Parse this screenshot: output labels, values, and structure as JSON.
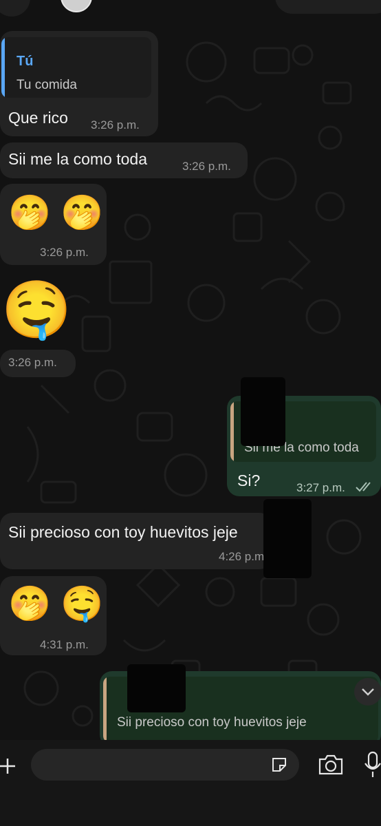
{
  "colors": {
    "chat_background": "#121212",
    "incoming_bubble": "#232323",
    "outgoing_bubble": "#1f3a2c",
    "reply_bar_blue": "#5aa7f5",
    "reply_bar_tan": "#c8a581",
    "read_check": "#a9c1b5"
  },
  "messages": [
    {
      "direction": "in",
      "reply_author": "Tú",
      "reply_text": "Tu comida",
      "text": "Que rico",
      "time": "3:26 p.m."
    },
    {
      "direction": "in",
      "text": "Sii me la como toda",
      "time": "3:26 p.m."
    },
    {
      "direction": "in",
      "emojis": "🤭 🤭",
      "time": "3:26 p.m."
    },
    {
      "direction": "in",
      "emojis": "🤤",
      "time": "3:26 p.m."
    },
    {
      "direction": "out",
      "reply_text": "Sii me la como toda",
      "text": "Si?",
      "time": "3:27 p.m.",
      "status_icon": "double-check-icon"
    },
    {
      "direction": "in",
      "text": "Sii precioso con toy huevitos jeje",
      "time": "4:26 p.m."
    },
    {
      "direction": "in",
      "emojis": "🤭 🤤",
      "time": "4:31 p.m."
    },
    {
      "direction": "out",
      "reply_text": "Sii precioso con toy huevitos jeje"
    }
  ],
  "composer": {
    "input_value": "",
    "icons": [
      "plus-icon",
      "sticker-icon",
      "camera-icon",
      "microphone-icon"
    ]
  }
}
